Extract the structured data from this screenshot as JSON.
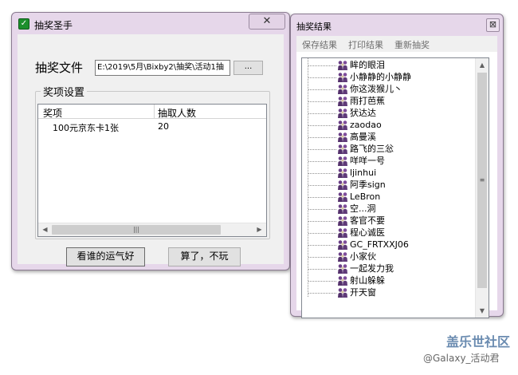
{
  "main_window": {
    "title": "抽奖圣手",
    "file_label": "抽奖文件",
    "file_path": "E:\\2019\\5月\\Bixby2\\抽奖\\活动1抽",
    "browse_label": "...",
    "group_title": "奖项设置",
    "columns": [
      "奖项",
      "抽取人数"
    ],
    "rows": [
      {
        "prize": "100元京东卡1张",
        "count": "20"
      }
    ],
    "btn_lucky": "看谁的运气好",
    "btn_quit": "算了，不玩"
  },
  "result_window": {
    "title": "抽奖结果",
    "close": "⊠",
    "menu": [
      "保存结果",
      "打印结果",
      "重新抽奖"
    ],
    "winners": [
      "眸的眼泪",
      "小静静的小静静",
      "你这泼猴儿丶",
      "雨打芭蕉",
      "犾达达",
      "zaodao",
      "高曼溪",
      "路飞的三忩",
      "咩咩一号",
      "ljinhui",
      "阿季sign",
      "LeBron",
      "空...洞",
      "客官不要",
      "程心诚医",
      "GC_FRTXXJ06",
      "小家伙",
      "一起发力我",
      "射山躲躲",
      "开天窗"
    ]
  },
  "watermark": {
    "line1": "盖乐世社区",
    "line2": "@Galaxy_活动君"
  },
  "colors": {
    "frame": "#e6d7ea",
    "client": "#f0f0f0",
    "icon_green": "#1c8f2c"
  }
}
